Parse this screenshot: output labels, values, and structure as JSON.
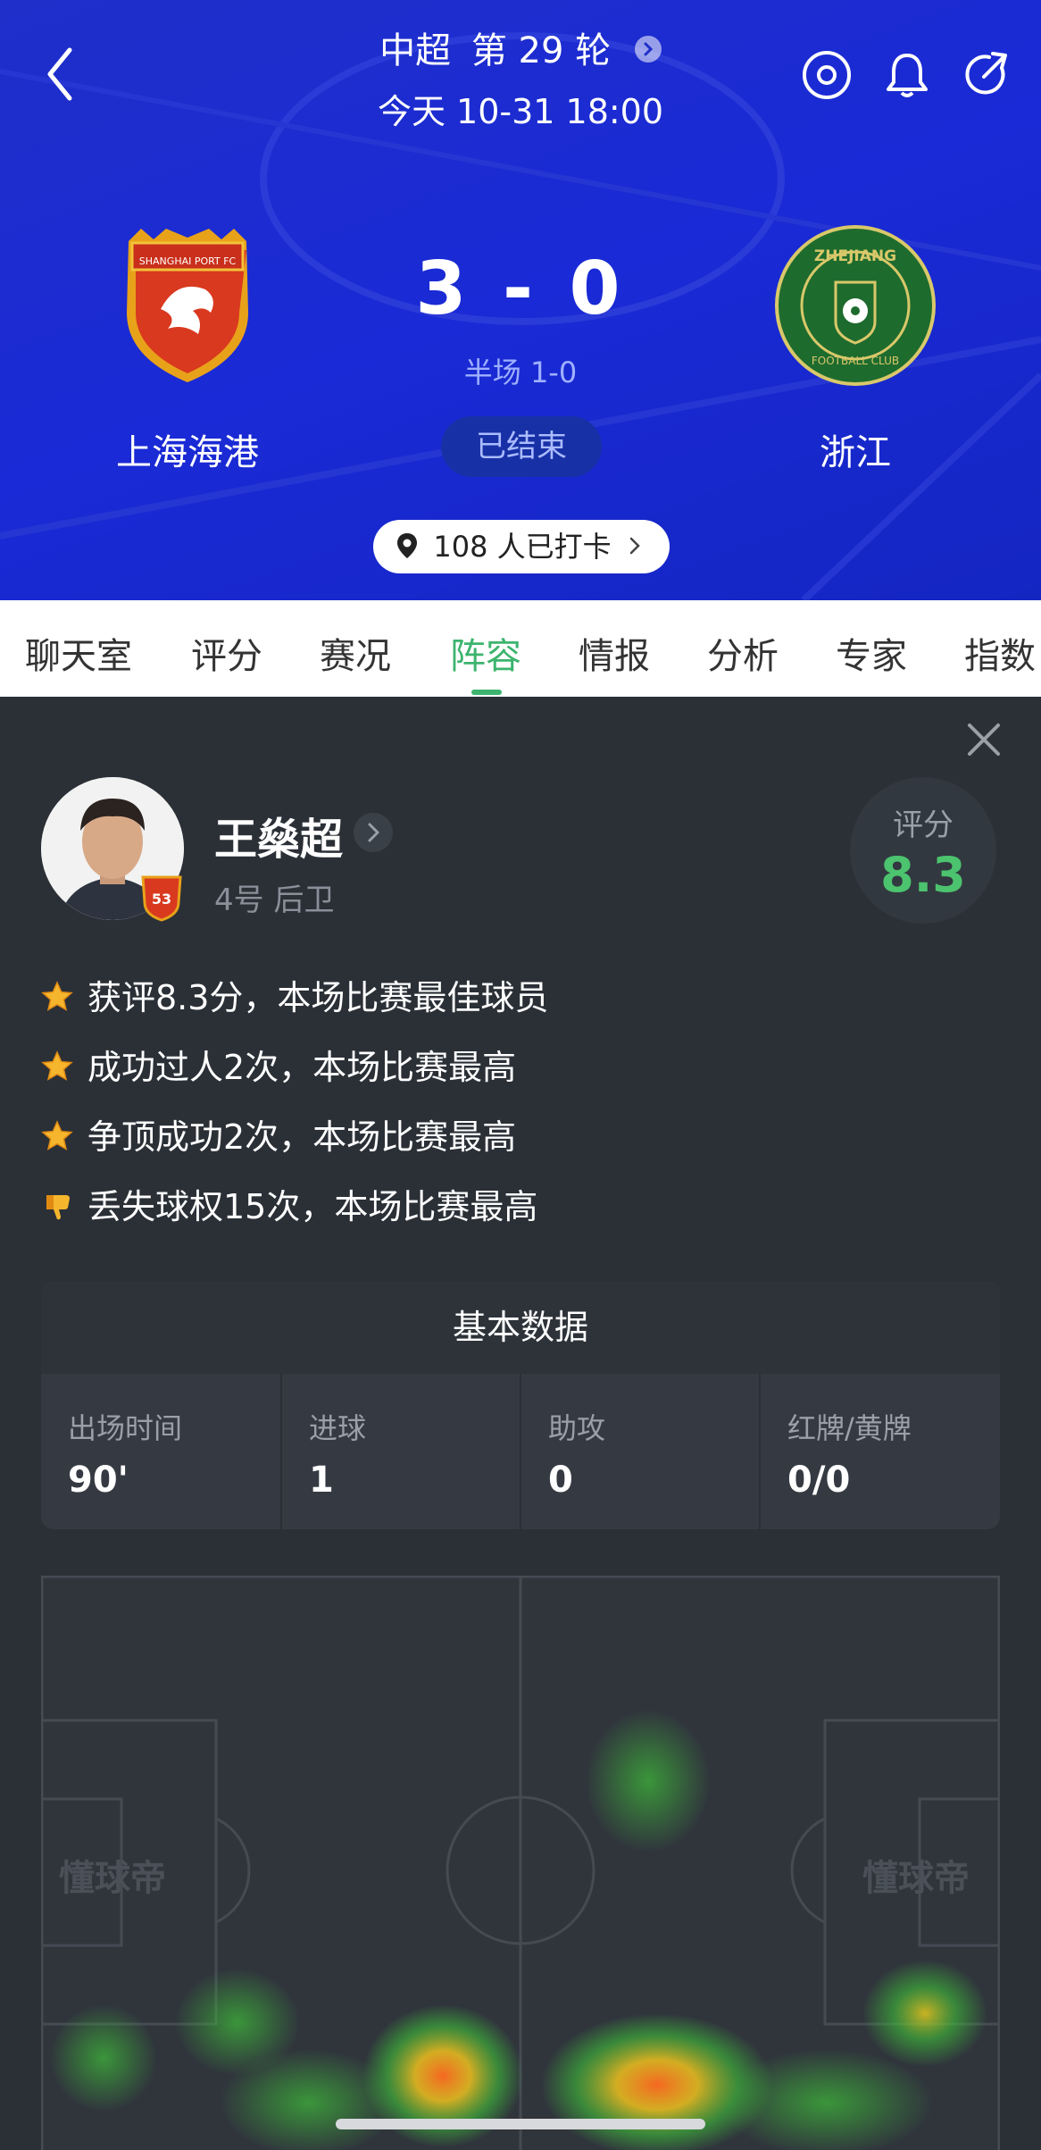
{
  "header": {
    "league": "中超",
    "round": "第 29 轮",
    "time": "今天 10-31 18:00",
    "home_team": "上海海港",
    "away_team": "浙江",
    "home_logo_text": "SHANGHAI PORT FC",
    "away_logo_text": "ZHEJIANG",
    "away_logo_sub": "FOOTBALL CLUB",
    "score": "3 - 0",
    "halftime": "半场 1-0",
    "status": "已结束",
    "checkin": "108 人已打卡"
  },
  "tabs": [
    {
      "label": "聊天室"
    },
    {
      "label": "评分"
    },
    {
      "label": "赛况"
    },
    {
      "label": "阵容",
      "active": true
    },
    {
      "label": "情报"
    },
    {
      "label": "分析"
    },
    {
      "label": "专家"
    },
    {
      "label": "指数"
    }
  ],
  "player": {
    "name": "王燊超",
    "number_position": "4号 后卫",
    "rating_label": "评分",
    "rating": "8.3",
    "badge_number": "53"
  },
  "highlights": [
    {
      "text": "获评8.3分，本场比赛最佳球员",
      "icon": "star-icon"
    },
    {
      "text": "成功过人2次，本场比赛最高",
      "icon": "star-icon"
    },
    {
      "text": "争顶成功2次，本场比赛最高",
      "icon": "star-icon"
    },
    {
      "text": "丢失球权15次，本场比赛最高",
      "icon": "thumb-down-icon"
    }
  ],
  "stats": {
    "title": "基本数据",
    "cells": [
      {
        "label": "出场时间",
        "value": "90'"
      },
      {
        "label": "进球",
        "value": "1"
      },
      {
        "label": "助攻",
        "value": "0"
      },
      {
        "label": "红牌/黄牌",
        "value": "0/0"
      }
    ]
  },
  "heatmap": {
    "watermark": "懂球帝"
  },
  "colors": {
    "header_blue": "#1f2fc9",
    "accent_green": "#3cb46e",
    "rating_green": "#4cc36e",
    "card_bg": "#2b3037"
  }
}
